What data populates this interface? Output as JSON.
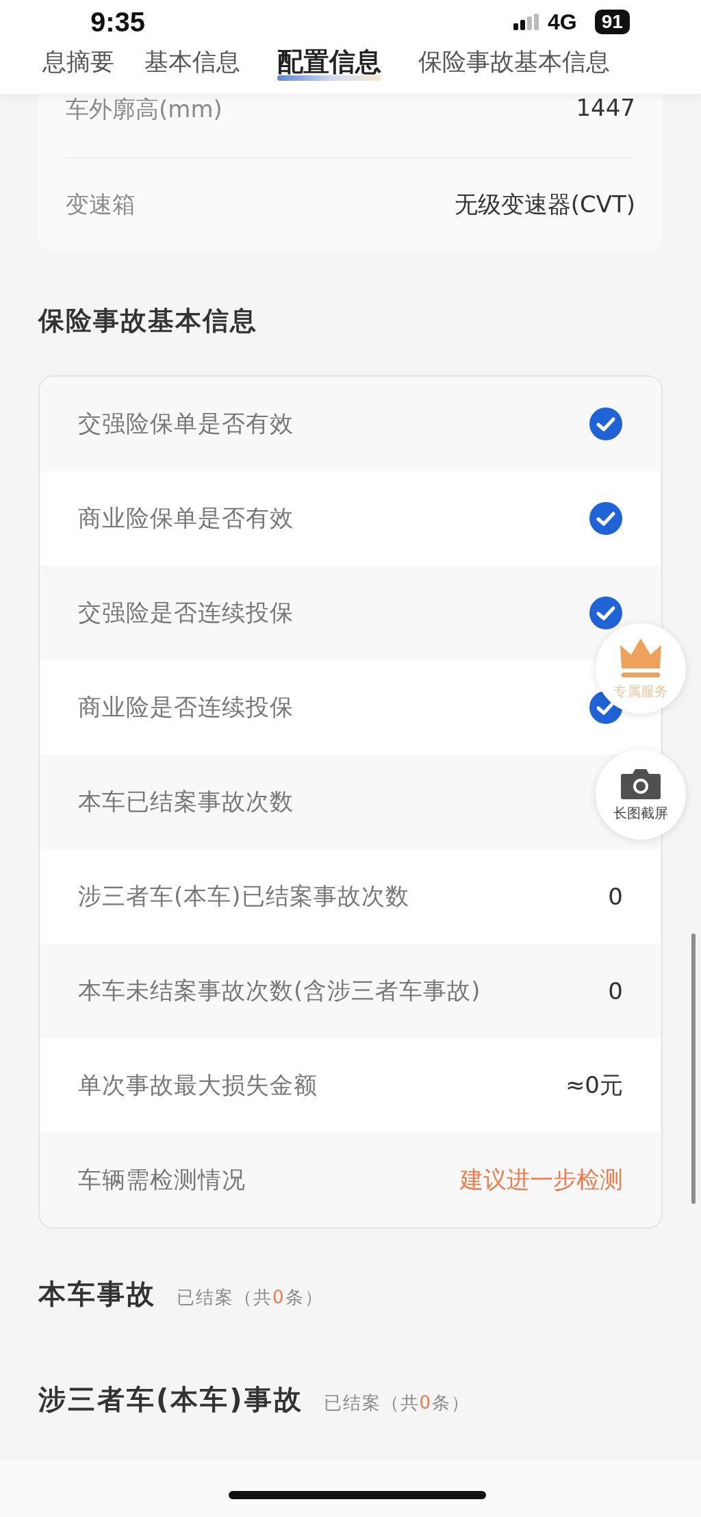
{
  "status_bar": {
    "time": "9:35",
    "network": "4G",
    "battery": "91"
  },
  "tabs": [
    {
      "label": "息摘要",
      "selected": false
    },
    {
      "label": "基本信息",
      "selected": false
    },
    {
      "label": "配置信息",
      "selected": true
    },
    {
      "label": "保险事故基本信息",
      "selected": false
    }
  ],
  "config_card": {
    "rows": [
      {
        "label": "车外廓高(mm)",
        "value": "1447"
      },
      {
        "label": "变速箱",
        "value": "无级变速器(CVT)"
      }
    ]
  },
  "insurance": {
    "title": "保险事故基本信息",
    "rows": [
      {
        "label": "交强险保单是否有效",
        "kind": "check",
        "checked": true
      },
      {
        "label": "商业险保单是否有效",
        "kind": "check",
        "checked": true
      },
      {
        "label": "交强险是否连续投保",
        "kind": "check",
        "checked": true
      },
      {
        "label": "商业险是否连续投保",
        "kind": "check",
        "checked": true
      },
      {
        "label": "本车已结案事故次数",
        "kind": "text"
      },
      {
        "label": "涉三者车(本车)已结案事故次数",
        "kind": "text",
        "value": "0"
      },
      {
        "label": "本车未结案事故次数(含涉三者车事故)",
        "kind": "text",
        "value": "0"
      },
      {
        "label": "单次事故最大损失金额",
        "kind": "text",
        "value": "≈0元"
      },
      {
        "label": "车辆需检测情况",
        "kind": "warning",
        "value": "建议进一步检测"
      }
    ]
  },
  "accident_sections": [
    {
      "title": "本车事故",
      "status": "已结案",
      "count_prefix": "（共",
      "count": "0",
      "count_suffix": "条）"
    },
    {
      "title": "涉三者车(本车)事故",
      "status": "已结案",
      "count_prefix": "（共",
      "count": "0",
      "count_suffix": "条）"
    }
  ],
  "floating_buttons": [
    {
      "kind": "crown",
      "label": "专属服务"
    },
    {
      "kind": "camera",
      "label": "长图截屏"
    }
  ]
}
